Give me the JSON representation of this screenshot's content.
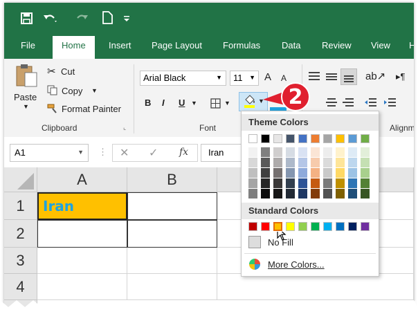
{
  "tabs": [
    "File",
    "Home",
    "Insert",
    "Page Layout",
    "Formulas",
    "Data",
    "Review",
    "View",
    "H"
  ],
  "clipboard": {
    "paste": "Paste",
    "cut": "Cut",
    "copy": "Copy",
    "format_painter": "Format Painter",
    "label": "Clipboard"
  },
  "font": {
    "name": "Arial Black",
    "size": "11",
    "bold": "B",
    "italic": "I",
    "underline": "U",
    "label": "Font",
    "grow": "A",
    "shrink": "A"
  },
  "alignment": {
    "label": "Alignm"
  },
  "namebox": "A1",
  "formula": {
    "fx": "fx",
    "value": "Iran"
  },
  "columns": [
    "A",
    "B"
  ],
  "rows": [
    "1",
    "2",
    "3",
    "4"
  ],
  "cells": {
    "A1": "Iran"
  },
  "callout": "2",
  "fill_menu": {
    "theme_title": "Theme Colors",
    "standard_title": "Standard Colors",
    "no_fill": "No Fill",
    "more_colors": "More Colors...",
    "theme_top": [
      "#ffffff",
      "#000000",
      "#e7e6e6",
      "#44546a",
      "#4472c4",
      "#ed7d31",
      "#a5a5a5",
      "#ffc000",
      "#5b9bd5",
      "#70ad47"
    ],
    "theme_shades": [
      [
        "#f2f2f2",
        "#7f7f7f",
        "#d0cece",
        "#d6dce4",
        "#d9e2f3",
        "#fbe5d5",
        "#ededed",
        "#fff2cc",
        "#deebf6",
        "#e2efd9"
      ],
      [
        "#d8d8d8",
        "#595959",
        "#aeabab",
        "#adb9ca",
        "#b4c6e7",
        "#f7cbac",
        "#dbdbdb",
        "#fee599",
        "#bdd7ee",
        "#c5e0b3"
      ],
      [
        "#bfbfbf",
        "#3f3f3f",
        "#757070",
        "#8496b0",
        "#8eaadb",
        "#f4b183",
        "#c9c9c9",
        "#ffd965",
        "#9cc3e5",
        "#a8d08d"
      ],
      [
        "#a5a5a5",
        "#262626",
        "#3a3838",
        "#323f4f",
        "#2f5496",
        "#c55a11",
        "#7b7b7b",
        "#bf9000",
        "#2e75b5",
        "#538135"
      ],
      [
        "#7f7f7f",
        "#0c0c0c",
        "#171616",
        "#222a35",
        "#1e3864",
        "#833c0b",
        "#525252",
        "#7f6000",
        "#1e4e79",
        "#375623"
      ]
    ],
    "standard": [
      "#c00000",
      "#ff0000",
      "#ffc000",
      "#ffff00",
      "#92d050",
      "#00b050",
      "#00b0f0",
      "#0070c0",
      "#002060",
      "#7030a0"
    ]
  },
  "colors": {
    "excel_green": "#217346",
    "cell_fill": "#ffc000",
    "text_fill": "#1fa3e0",
    "callout": "#e0202f"
  }
}
